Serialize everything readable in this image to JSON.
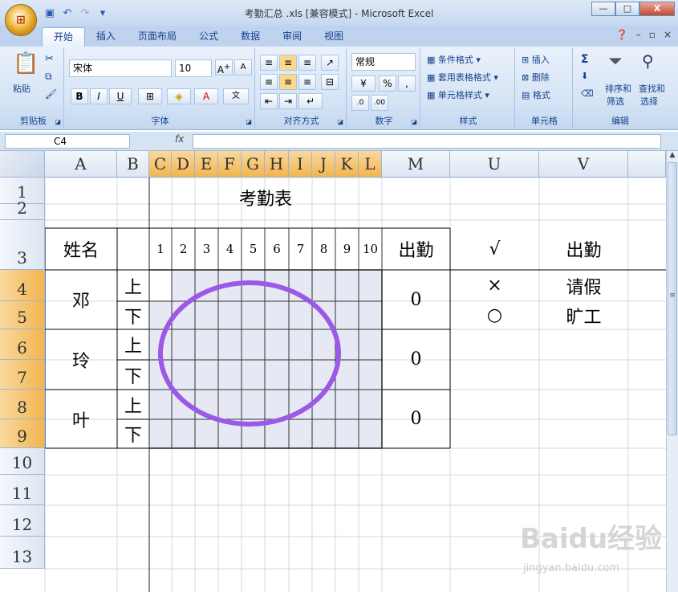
{
  "app": {
    "title": "考勤汇总 .xls  [兼容模式] - Microsoft Excel",
    "logo": "office-logo"
  },
  "qat": {
    "icons": [
      "save-icon",
      "undo-icon",
      "redo-icon",
      "customize-icon"
    ]
  },
  "window": {
    "min": "—",
    "max": "□",
    "close": "X"
  },
  "tabs": [
    "开始",
    "插入",
    "页面布局",
    "公式",
    "数据",
    "审阅",
    "视图"
  ],
  "ribbon": {
    "clipboard": {
      "label": "剪贴板",
      "paste": "粘贴"
    },
    "font": {
      "label": "字体",
      "family": "宋体",
      "size": "10",
      "bold": "B",
      "italic": "I",
      "underline": "U"
    },
    "align": {
      "label": "对齐方式"
    },
    "number": {
      "label": "数字",
      "format": "常规",
      "percent": "%",
      "comma": ","
    },
    "styles": {
      "label": "样式",
      "cond": "条件格式",
      "table": "套用表格格式",
      "cell": "单元格样式"
    },
    "cells": {
      "label": "单元格",
      "insert": "插入",
      "delete": "删除",
      "format": "格式"
    },
    "edit": {
      "label": "编辑",
      "sigma": "Σ",
      "sort": "排序和",
      "sort2": "筛选",
      "find": "查找和",
      "find2": "选择"
    }
  },
  "formula": {
    "namebox": "C4",
    "fx": "fx",
    "value": ""
  },
  "columns": [
    "A",
    "B",
    "C",
    "D",
    "E",
    "F",
    "G",
    "H",
    "I",
    "J",
    "K",
    "L",
    "M",
    "U",
    "V"
  ],
  "rows": [
    "1",
    "2",
    "3",
    "4",
    "5",
    "6",
    "7",
    "8",
    "9",
    "10",
    "11",
    "12",
    "13"
  ],
  "sheet": {
    "title": "考勤表",
    "h_name": "姓名",
    "days": [
      "1",
      "2",
      "3",
      "4",
      "5",
      "6",
      "7",
      "8",
      "9",
      "10"
    ],
    "h_attend": "出勤",
    "people": [
      {
        "name": "邓",
        "am": "上",
        "pm": "下",
        "count": "0"
      },
      {
        "name": "玲",
        "am": "上",
        "pm": "下",
        "count": "0"
      },
      {
        "name": "叶",
        "am": "上",
        "pm": "下",
        "count": "0"
      }
    ],
    "legend": [
      {
        "sym": "√",
        "text": "出勤"
      },
      {
        "sym": "×",
        "text": "请假"
      },
      {
        "sym": "○",
        "text": "旷工"
      }
    ]
  },
  "watermark": {
    "text": "Baidu经验",
    "url": "jingyan.baidu.com"
  },
  "colors": {
    "highlight": "#f2b54f",
    "ellipse": "#9b59e6",
    "range": "#e6e9f4"
  }
}
